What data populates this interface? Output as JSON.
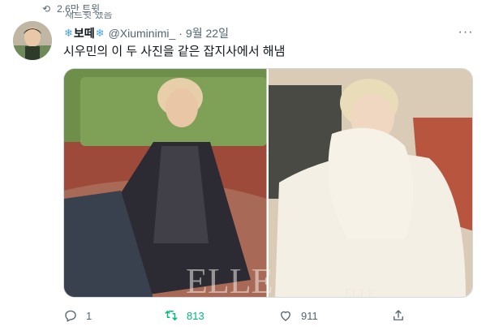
{
  "retweet_info": {
    "count_text": "2.6만 트윗",
    "cut_text": "재트윗 했음"
  },
  "tweet": {
    "display_name_text": "보떼",
    "name_emoji": "❄",
    "handle": "@Xiuminimi_",
    "separator": "·",
    "date": "9월 22일",
    "more_glyph": "···",
    "text": "시우민의 이 두 사진을 같은 잡지사에서 해냄",
    "media": {
      "left_watermark": "ELLE",
      "right_watermark": "ELLE"
    },
    "actions": {
      "reply_count": "1",
      "retweet_count": "813",
      "like_count": "911"
    }
  },
  "colors": {
    "accent_retweet": "#00ba7c",
    "secondary_text": "#536471",
    "snowflake": "#4aa3df"
  },
  "icons": [
    "retweet-icon",
    "avatar",
    "snowflake-icon",
    "more-icon",
    "reply-icon",
    "retweet-action-icon",
    "like-icon",
    "share-icon"
  ]
}
